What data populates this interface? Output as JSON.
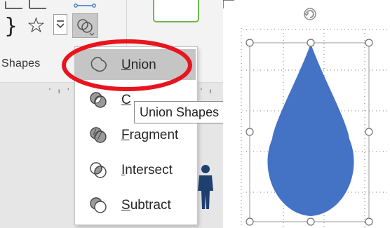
{
  "ribbon": {
    "group_label": "Shapes",
    "curly_glyph": "}",
    "star_glyph": "☆",
    "scroll_glyph": "⊽",
    "merge_button_icon": "merge-shapes-icon"
  },
  "merge_menu": {
    "items": [
      {
        "prefix": "",
        "underline": "U",
        "rest": "nion",
        "icon": "union-icon",
        "highlighted": true
      },
      {
        "prefix": "",
        "underline": "C",
        "rest": "",
        "icon": "combine-icon",
        "highlighted": false
      },
      {
        "prefix": "",
        "underline": "F",
        "rest": "ragment",
        "icon": "fragment-icon",
        "highlighted": false
      },
      {
        "prefix": "",
        "underline": "I",
        "rest": "ntersect",
        "icon": "intersect-icon",
        "highlighted": false
      },
      {
        "prefix": "",
        "underline": "S",
        "rest": "ubtract",
        "icon": "subtract-icon",
        "highlighted": false
      }
    ]
  },
  "tooltip": {
    "text": "Union Shapes"
  },
  "canvas": {
    "shape": "teardrop",
    "shape_fill": "#4472c4",
    "annotation_color": "#e8141e",
    "rotate_handle_icon": "rotate-icon"
  }
}
